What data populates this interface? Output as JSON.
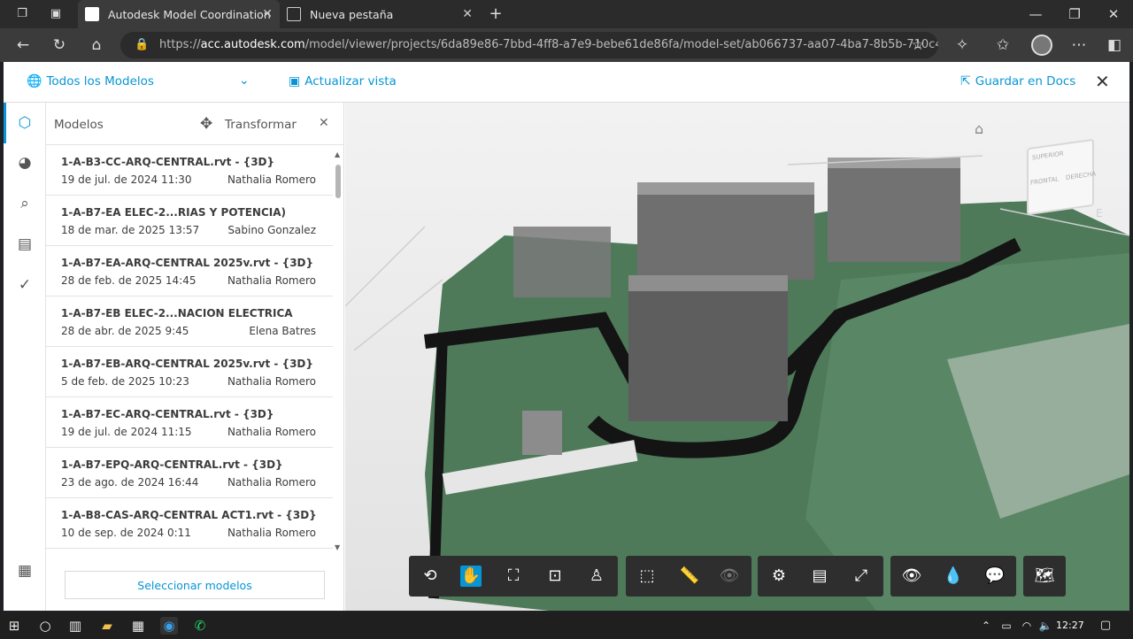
{
  "browser": {
    "tabs": [
      {
        "title": "Autodesk Model Coordination",
        "active": true
      },
      {
        "title": "Nueva pestaña",
        "active": false
      }
    ],
    "url_prefix": "https://",
    "url_domain": "acc.autodesk.com",
    "url_path": "/model/viewer/projects/6da89e86-7bbd-4ff8-a7e9-bebe61de86fa/model-set/ab066737-aa07-4ba7-8b5b-710c42ce..."
  },
  "header": {
    "models_dropdown": "Todos los Modelos",
    "refresh_view": "Actualizar vista",
    "save_docs": "Guardar en Docs"
  },
  "panel": {
    "title": "Modelos",
    "transform": "Transformar",
    "select_models": "Seleccionar modelos",
    "items": [
      {
        "name": "1-A-B3-CC-ARQ-CENTRAL.rvt - {3D}",
        "date": "19 de jul. de 2024 11:30",
        "user": "Nathalia Romero"
      },
      {
        "name": "1-A-B7-EA ELEC-2...RIAS Y POTENCIA)",
        "date": "18 de mar. de 2025 13:57",
        "user": "Sabino Gonzalez"
      },
      {
        "name": "1-A-B7-EA-ARQ-CENTRAL 2025v.rvt - {3D}",
        "date": "28 de feb. de 2025 14:45",
        "user": "Nathalia Romero"
      },
      {
        "name": "1-A-B7-EB ELEC-2...NACION ELECTRICA",
        "date": "28 de abr. de 2025 9:45",
        "user": "Elena Batres"
      },
      {
        "name": "1-A-B7-EB-ARQ-CENTRAL 2025v.rvt - {3D}",
        "date": "5 de feb. de 2025 10:23",
        "user": "Nathalia Romero"
      },
      {
        "name": "1-A-B7-EC-ARQ-CENTRAL.rvt - {3D}",
        "date": "19 de jul. de 2024 11:15",
        "user": "Nathalia Romero"
      },
      {
        "name": "1-A-B7-EPQ-ARQ-CENTRAL.rvt - {3D}",
        "date": "23 de ago. de 2024 16:44",
        "user": "Nathalia Romero"
      },
      {
        "name": "1-A-B8-CAS-ARQ-CENTRAL ACT1.rvt - {3D}",
        "date": "10 de sep. de 2024 0:11",
        "user": "Nathalia Romero"
      }
    ]
  },
  "viewcube": {
    "front": "FRONTAL",
    "right": "DERECHA",
    "top": "SUPERIOR",
    "compass": "E"
  },
  "taskbar": {
    "time": "12:27"
  },
  "colors": {
    "accent": "#0696d7",
    "terrain": "#4e7a5a",
    "toolbar": "#2e2e2e"
  }
}
